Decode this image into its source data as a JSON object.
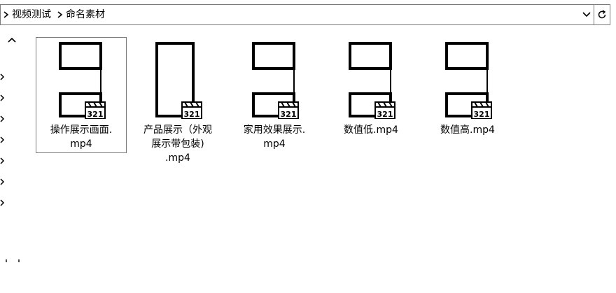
{
  "address": {
    "breadcrumb": [
      "视频测试",
      "命名素材"
    ]
  },
  "files": [
    {
      "name": "操作展示画面.mp4",
      "line1": "操作展示画面.",
      "line2": "mp4",
      "line3": "",
      "thumb": "split",
      "selected": true
    },
    {
      "name": "产品展示（外观展示带包装).mp4",
      "line1": "产品展示（外观",
      "line2": "展示带包装)",
      "line3": ".mp4",
      "thumb": "tall",
      "selected": false
    },
    {
      "name": "家用效果展示.mp4",
      "line1": "家用效果展示.",
      "line2": "mp4",
      "line3": "",
      "thumb": "split",
      "selected": false
    },
    {
      "name": "数值低.mp4",
      "line1": "数值低.mp4",
      "line2": "",
      "line3": "",
      "thumb": "split",
      "selected": false
    },
    {
      "name": "数值高.mp4",
      "line1": "数值高.mp4",
      "line2": "",
      "line3": "",
      "thumb": "split",
      "selected": false
    }
  ],
  "icons": {
    "breadcrumb_separator": "chevron-right-icon",
    "dropdown": "chevron-down-icon",
    "refresh": "refresh-icon",
    "scroll_up": "scroll-up-icon",
    "video_badge": "video-file-icon"
  }
}
